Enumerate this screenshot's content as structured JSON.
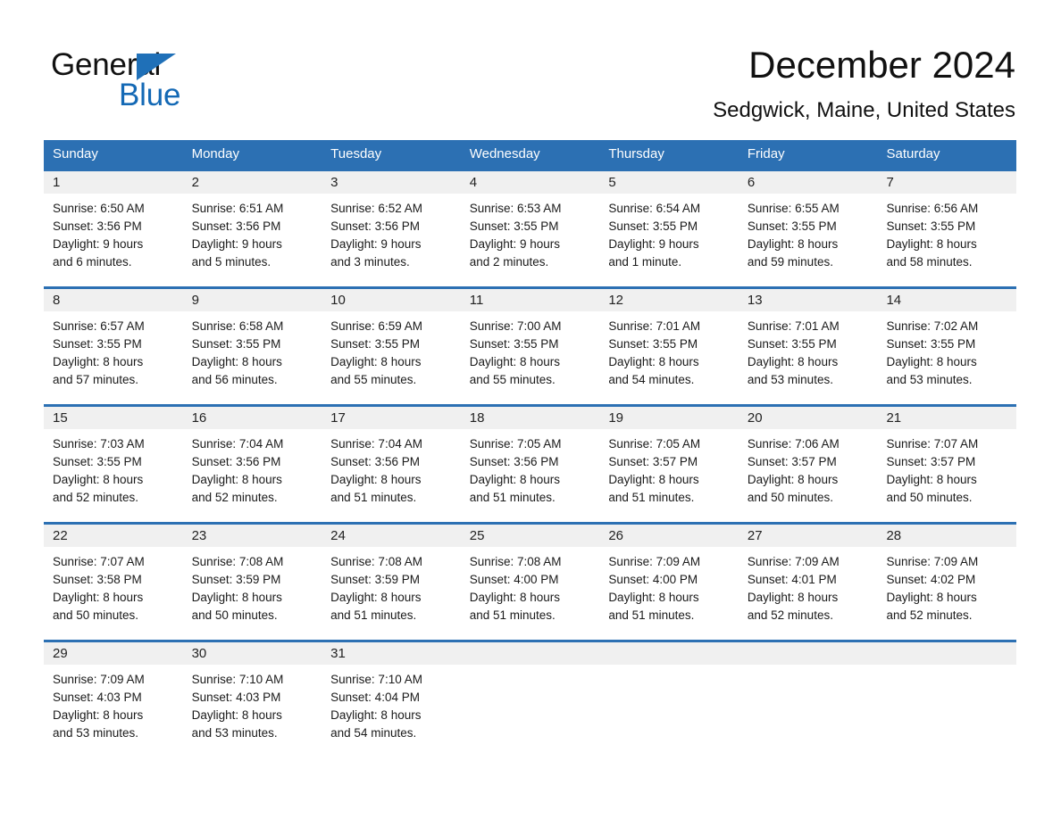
{
  "logo": {
    "word1": "General",
    "word2": "Blue",
    "triangle_color": "#1f70b8",
    "word2_color": "#1469b5"
  },
  "header": {
    "title": "December 2024",
    "subtitle": "Sedgwick, Maine, United States"
  },
  "theme": {
    "header_blue": "#2c70b3",
    "day_band_gray": "#f0f0f0",
    "text": "#1a1a1a"
  },
  "weekdays": [
    "Sunday",
    "Monday",
    "Tuesday",
    "Wednesday",
    "Thursday",
    "Friday",
    "Saturday"
  ],
  "weeks": [
    [
      {
        "day": "1",
        "sunrise": "Sunrise: 6:50 AM",
        "sunset": "Sunset: 3:56 PM",
        "daylight1": "Daylight: 9 hours",
        "daylight2": "and 6 minutes."
      },
      {
        "day": "2",
        "sunrise": "Sunrise: 6:51 AM",
        "sunset": "Sunset: 3:56 PM",
        "daylight1": "Daylight: 9 hours",
        "daylight2": "and 5 minutes."
      },
      {
        "day": "3",
        "sunrise": "Sunrise: 6:52 AM",
        "sunset": "Sunset: 3:56 PM",
        "daylight1": "Daylight: 9 hours",
        "daylight2": "and 3 minutes."
      },
      {
        "day": "4",
        "sunrise": "Sunrise: 6:53 AM",
        "sunset": "Sunset: 3:55 PM",
        "daylight1": "Daylight: 9 hours",
        "daylight2": "and 2 minutes."
      },
      {
        "day": "5",
        "sunrise": "Sunrise: 6:54 AM",
        "sunset": "Sunset: 3:55 PM",
        "daylight1": "Daylight: 9 hours",
        "daylight2": "and 1 minute."
      },
      {
        "day": "6",
        "sunrise": "Sunrise: 6:55 AM",
        "sunset": "Sunset: 3:55 PM",
        "daylight1": "Daylight: 8 hours",
        "daylight2": "and 59 minutes."
      },
      {
        "day": "7",
        "sunrise": "Sunrise: 6:56 AM",
        "sunset": "Sunset: 3:55 PM",
        "daylight1": "Daylight: 8 hours",
        "daylight2": "and 58 minutes."
      }
    ],
    [
      {
        "day": "8",
        "sunrise": "Sunrise: 6:57 AM",
        "sunset": "Sunset: 3:55 PM",
        "daylight1": "Daylight: 8 hours",
        "daylight2": "and 57 minutes."
      },
      {
        "day": "9",
        "sunrise": "Sunrise: 6:58 AM",
        "sunset": "Sunset: 3:55 PM",
        "daylight1": "Daylight: 8 hours",
        "daylight2": "and 56 minutes."
      },
      {
        "day": "10",
        "sunrise": "Sunrise: 6:59 AM",
        "sunset": "Sunset: 3:55 PM",
        "daylight1": "Daylight: 8 hours",
        "daylight2": "and 55 minutes."
      },
      {
        "day": "11",
        "sunrise": "Sunrise: 7:00 AM",
        "sunset": "Sunset: 3:55 PM",
        "daylight1": "Daylight: 8 hours",
        "daylight2": "and 55 minutes."
      },
      {
        "day": "12",
        "sunrise": "Sunrise: 7:01 AM",
        "sunset": "Sunset: 3:55 PM",
        "daylight1": "Daylight: 8 hours",
        "daylight2": "and 54 minutes."
      },
      {
        "day": "13",
        "sunrise": "Sunrise: 7:01 AM",
        "sunset": "Sunset: 3:55 PM",
        "daylight1": "Daylight: 8 hours",
        "daylight2": "and 53 minutes."
      },
      {
        "day": "14",
        "sunrise": "Sunrise: 7:02 AM",
        "sunset": "Sunset: 3:55 PM",
        "daylight1": "Daylight: 8 hours",
        "daylight2": "and 53 minutes."
      }
    ],
    [
      {
        "day": "15",
        "sunrise": "Sunrise: 7:03 AM",
        "sunset": "Sunset: 3:55 PM",
        "daylight1": "Daylight: 8 hours",
        "daylight2": "and 52 minutes."
      },
      {
        "day": "16",
        "sunrise": "Sunrise: 7:04 AM",
        "sunset": "Sunset: 3:56 PM",
        "daylight1": "Daylight: 8 hours",
        "daylight2": "and 52 minutes."
      },
      {
        "day": "17",
        "sunrise": "Sunrise: 7:04 AM",
        "sunset": "Sunset: 3:56 PM",
        "daylight1": "Daylight: 8 hours",
        "daylight2": "and 51 minutes."
      },
      {
        "day": "18",
        "sunrise": "Sunrise: 7:05 AM",
        "sunset": "Sunset: 3:56 PM",
        "daylight1": "Daylight: 8 hours",
        "daylight2": "and 51 minutes."
      },
      {
        "day": "19",
        "sunrise": "Sunrise: 7:05 AM",
        "sunset": "Sunset: 3:57 PM",
        "daylight1": "Daylight: 8 hours",
        "daylight2": "and 51 minutes."
      },
      {
        "day": "20",
        "sunrise": "Sunrise: 7:06 AM",
        "sunset": "Sunset: 3:57 PM",
        "daylight1": "Daylight: 8 hours",
        "daylight2": "and 50 minutes."
      },
      {
        "day": "21",
        "sunrise": "Sunrise: 7:07 AM",
        "sunset": "Sunset: 3:57 PM",
        "daylight1": "Daylight: 8 hours",
        "daylight2": "and 50 minutes."
      }
    ],
    [
      {
        "day": "22",
        "sunrise": "Sunrise: 7:07 AM",
        "sunset": "Sunset: 3:58 PM",
        "daylight1": "Daylight: 8 hours",
        "daylight2": "and 50 minutes."
      },
      {
        "day": "23",
        "sunrise": "Sunrise: 7:08 AM",
        "sunset": "Sunset: 3:59 PM",
        "daylight1": "Daylight: 8 hours",
        "daylight2": "and 50 minutes."
      },
      {
        "day": "24",
        "sunrise": "Sunrise: 7:08 AM",
        "sunset": "Sunset: 3:59 PM",
        "daylight1": "Daylight: 8 hours",
        "daylight2": "and 51 minutes."
      },
      {
        "day": "25",
        "sunrise": "Sunrise: 7:08 AM",
        "sunset": "Sunset: 4:00 PM",
        "daylight1": "Daylight: 8 hours",
        "daylight2": "and 51 minutes."
      },
      {
        "day": "26",
        "sunrise": "Sunrise: 7:09 AM",
        "sunset": "Sunset: 4:00 PM",
        "daylight1": "Daylight: 8 hours",
        "daylight2": "and 51 minutes."
      },
      {
        "day": "27",
        "sunrise": "Sunrise: 7:09 AM",
        "sunset": "Sunset: 4:01 PM",
        "daylight1": "Daylight: 8 hours",
        "daylight2": "and 52 minutes."
      },
      {
        "day": "28",
        "sunrise": "Sunrise: 7:09 AM",
        "sunset": "Sunset: 4:02 PM",
        "daylight1": "Daylight: 8 hours",
        "daylight2": "and 52 minutes."
      }
    ],
    [
      {
        "day": "29",
        "sunrise": "Sunrise: 7:09 AM",
        "sunset": "Sunset: 4:03 PM",
        "daylight1": "Daylight: 8 hours",
        "daylight2": "and 53 minutes."
      },
      {
        "day": "30",
        "sunrise": "Sunrise: 7:10 AM",
        "sunset": "Sunset: 4:03 PM",
        "daylight1": "Daylight: 8 hours",
        "daylight2": "and 53 minutes."
      },
      {
        "day": "31",
        "sunrise": "Sunrise: 7:10 AM",
        "sunset": "Sunset: 4:04 PM",
        "daylight1": "Daylight: 8 hours",
        "daylight2": "and 54 minutes."
      },
      {
        "day": "",
        "sunrise": "",
        "sunset": "",
        "daylight1": "",
        "daylight2": ""
      },
      {
        "day": "",
        "sunrise": "",
        "sunset": "",
        "daylight1": "",
        "daylight2": ""
      },
      {
        "day": "",
        "sunrise": "",
        "sunset": "",
        "daylight1": "",
        "daylight2": ""
      },
      {
        "day": "",
        "sunrise": "",
        "sunset": "",
        "daylight1": "",
        "daylight2": ""
      }
    ]
  ]
}
